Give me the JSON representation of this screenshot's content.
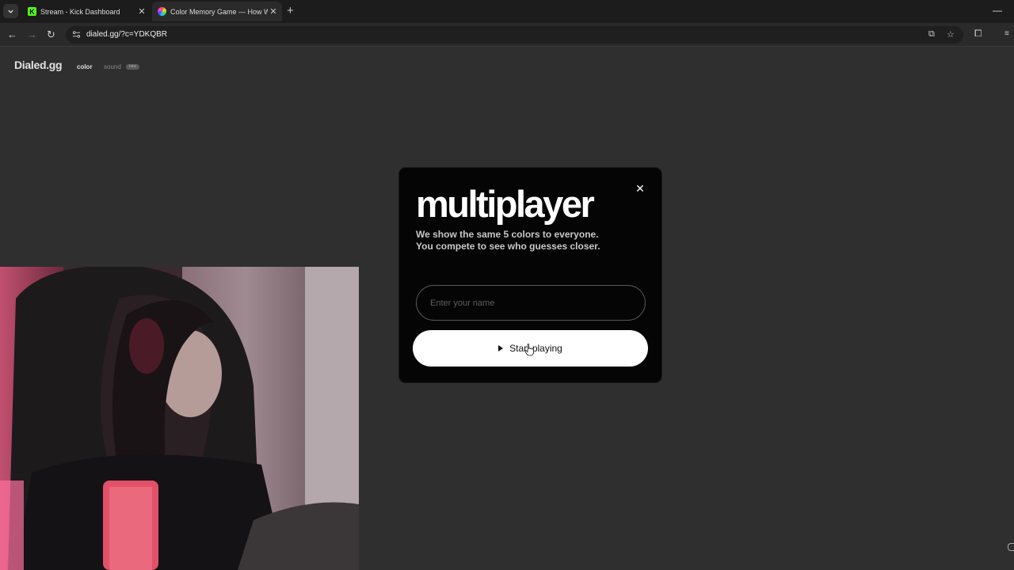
{
  "browser": {
    "tabs": [
      {
        "title": "Stream - Kick Dashboard",
        "favicon": "kick-logo-icon",
        "active": false
      },
      {
        "title": "Color Memory Game — How W",
        "favicon": "color-wheel-icon",
        "active": true
      }
    ],
    "url": "dialed.gg/?c=YDKQBR"
  },
  "site": {
    "logo": "Dialed.gg",
    "nav_color": "color",
    "nav_sound": "sound",
    "sound_badge": "new"
  },
  "modal": {
    "title": "multiplayer",
    "description_line1": "We show the same 5 colors to everyone.",
    "description_line2": "You compete to see who guesses closer.",
    "name_placeholder": "Enter your name",
    "name_value": "",
    "start_label": "Start playing"
  },
  "colors": {
    "page_bg": "#2f2f2f",
    "modal_bg": "#050505",
    "button_bg": "#ffffff",
    "kick_green": "#53fc18"
  }
}
